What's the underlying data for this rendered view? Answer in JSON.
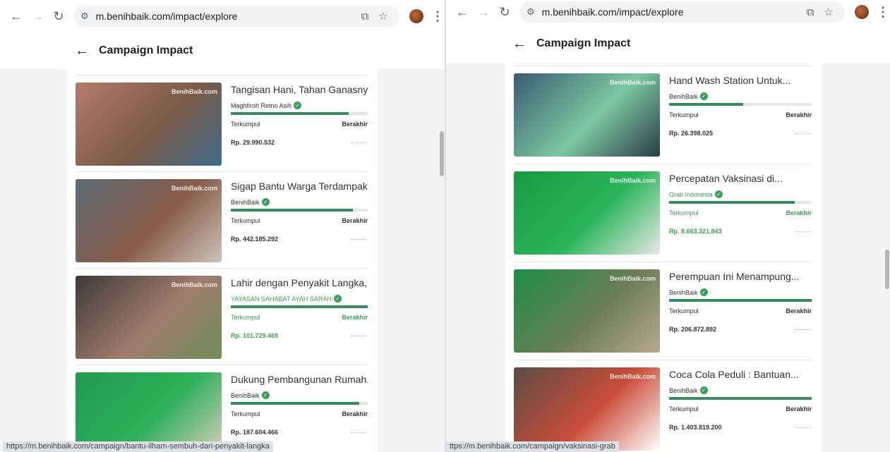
{
  "left": {
    "browser": {
      "url": "m.benihbaik.com/impact/explore"
    },
    "page_title": "Campaign Impact",
    "status_url": "https://m.benihbaik.com/campaign/bantu-ilham-sembuh-dari-penyakit-langka",
    "cards": [
      {
        "title": "Tangisan Hani, Tahan Ganasnya...",
        "owner": "Maghfiroh Retno Asih",
        "progress": 0.86,
        "collected_label": "Terkumpul",
        "status": "Berakhir",
        "amount": "Rp. 29.990.532",
        "dots": "------",
        "highlight": false,
        "watermark": "BenihBaik.com",
        "colors": [
          "#b67b6a",
          "#7c5a48",
          "#3f6b8a"
        ]
      },
      {
        "title": "Sigap Bantu Warga Terdampak...",
        "owner": "BenihBaik",
        "progress": 0.89,
        "collected_label": "Terkumpul",
        "status": "Berakhir",
        "amount": "Rp. 442.185.292",
        "dots": "------",
        "highlight": false,
        "watermark": "BenihBaik.com",
        "colors": [
          "#5b6b75",
          "#8a5c4a",
          "#c9c3b8"
        ]
      },
      {
        "title": "Lahir dengan Penyakit Langka,...",
        "owner": "YAYASAN SAHABAT AYAH SARAH",
        "progress": 1.0,
        "collected_label": "Terkumpul",
        "status": "Berakhir",
        "amount": "Rp. 101.729.469",
        "dots": "------",
        "highlight": true,
        "watermark": "BenihBaik.com",
        "colors": [
          "#3d3a39",
          "#a07b6d",
          "#6e8f57"
        ]
      },
      {
        "title": "Dukung Pembangunan Rumah...",
        "owner": "BenihBaik",
        "progress": 0.94,
        "collected_label": "Terkumpul",
        "status": "Berakhir",
        "amount": "Rp. 187.604.466",
        "dots": "------",
        "highlight": false,
        "watermark": "",
        "colors": [
          "#1f9a4e",
          "#2fb05a",
          "#d9cfc0"
        ]
      }
    ]
  },
  "right": {
    "browser": {
      "url": "m.benihbaik.com/impact/explore"
    },
    "page_title": "Campaign Impact",
    "status_url": "ttps://m.benihbaik.com/campaign/vaksinasi-grab",
    "cards": [
      {
        "title": "Hand Wash Station Untuk...",
        "owner": "BenihBaik",
        "progress": 0.52,
        "collected_label": "Terkumpul",
        "status": "Berakhir",
        "amount": "Rp. 26.398.025",
        "dots": "------",
        "highlight": false,
        "watermark": "BenihBaik.com",
        "colors": [
          "#3c5b73",
          "#7bc8a0",
          "#2a3a4a"
        ]
      },
      {
        "title": "Percepatan Vaksinasi di...",
        "owner": "Grab Indonesia",
        "progress": 0.88,
        "collected_label": "Terkumpul",
        "status": "Berakhir",
        "amount": "Rp. 8.663.321.843",
        "dots": "------",
        "highlight": true,
        "watermark": "BenihBaik.com",
        "colors": [
          "#169a45",
          "#2ab55a",
          "#e8e8e8"
        ]
      },
      {
        "title": "Perempuan Ini Menampung...",
        "owner": "BenihBaik",
        "progress": 1.0,
        "collected_label": "Terkumpul",
        "status": "Berakhir",
        "amount": "Rp. 206.872.892",
        "dots": "------",
        "highlight": false,
        "watermark": "BenihBaik.com",
        "colors": [
          "#1c8f43",
          "#6a7d56",
          "#b9a88e"
        ]
      },
      {
        "title": "Coca Cola Peduli : Bantuan...",
        "owner": "BenihBaik",
        "progress": 1.0,
        "collected_label": "Terkumpul",
        "status": "Berakhir",
        "amount": "Rp. 1.403.819.200",
        "dots": "------",
        "highlight": false,
        "watermark": "BenihBaik.com",
        "colors": [
          "#5b4b45",
          "#c94d3a",
          "#ffffff"
        ]
      }
    ]
  }
}
